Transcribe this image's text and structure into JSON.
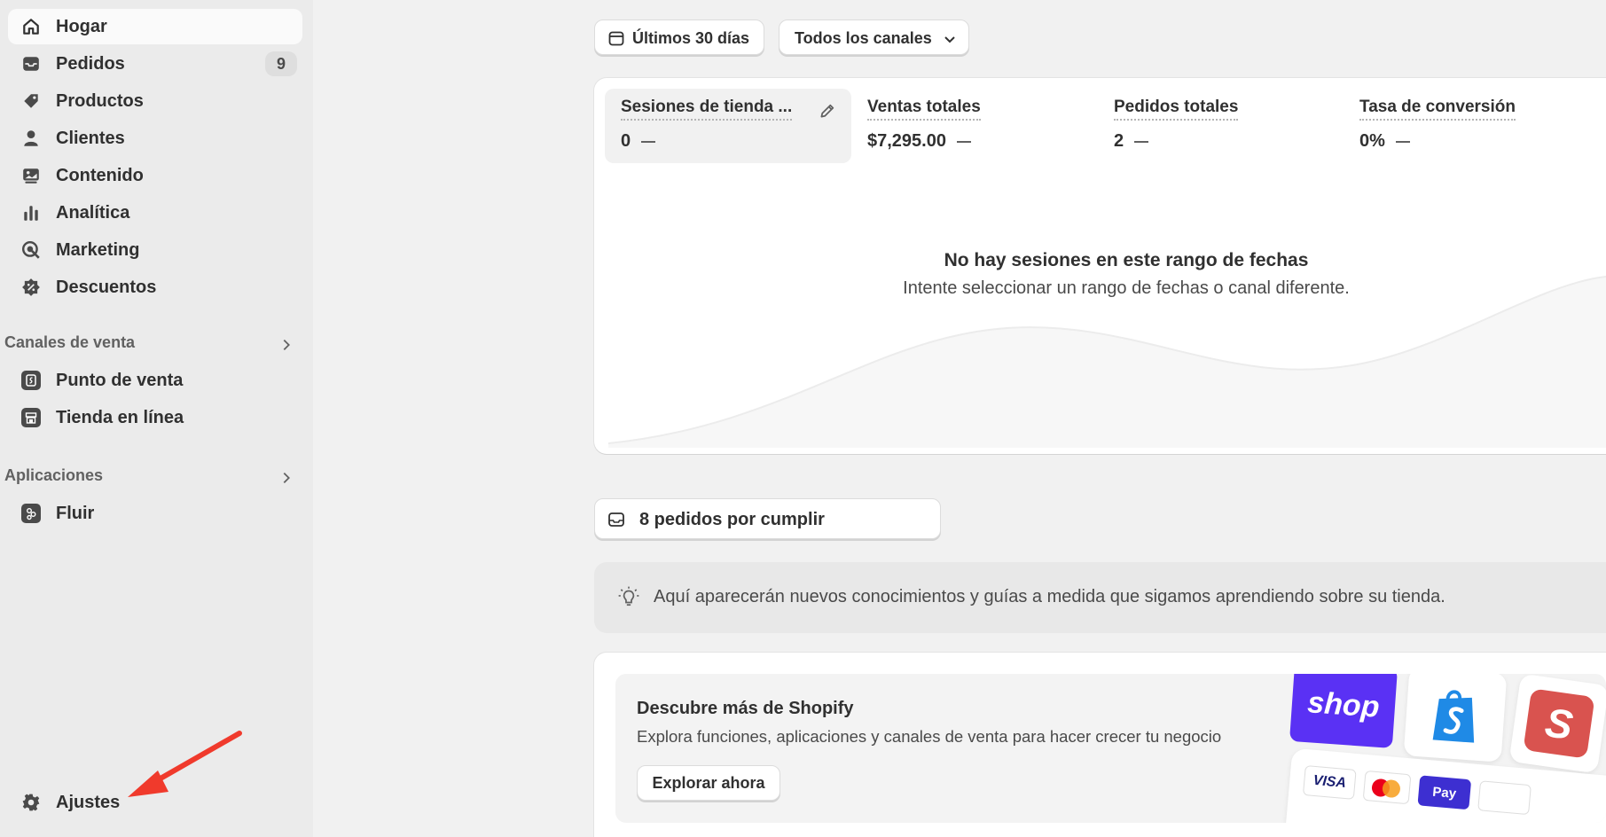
{
  "sidebar": {
    "nav": [
      {
        "label": "Hogar",
        "icon": "home-icon",
        "active": true
      },
      {
        "label": "Pedidos",
        "icon": "inbox-icon",
        "badge": "9"
      },
      {
        "label": "Productos",
        "icon": "tag-icon"
      },
      {
        "label": "Clientes",
        "icon": "person-icon"
      },
      {
        "label": "Contenido",
        "icon": "image-icon"
      },
      {
        "label": "Analítica",
        "icon": "bar-chart-icon"
      },
      {
        "label": "Marketing",
        "icon": "target-icon"
      },
      {
        "label": "Descuentos",
        "icon": "discount-icon"
      }
    ],
    "sales_channels": {
      "title": "Canales de venta",
      "items": [
        {
          "label": "Punto de venta",
          "icon": "pos-icon"
        },
        {
          "label": "Tienda en línea",
          "icon": "storefront-icon"
        }
      ]
    },
    "apps": {
      "title": "Aplicaciones",
      "items": [
        {
          "label": "Fluir",
          "icon": "flow-icon"
        }
      ]
    },
    "settings_label": "Ajustes"
  },
  "filters": {
    "date_range": "Últimos 30 días",
    "channel": "Todos los canales"
  },
  "metrics": [
    {
      "label": "Sesiones de tienda ...",
      "value": "0",
      "selected": true
    },
    {
      "label": "Ventas totales",
      "value": "$7,295.00"
    },
    {
      "label": "Pedidos totales",
      "value": "2"
    },
    {
      "label": "Tasa de conversión",
      "value": "0%"
    }
  ],
  "empty_state": {
    "title": "No hay sesiones en este rango de fechas",
    "subtitle": "Intente seleccionar un rango de fechas o canal diferente."
  },
  "orders_pill": "8 pedidos por cumplir",
  "insight_text": "Aquí aparecerán nuevos conocimientos y guías a medida que sigamos aprendiendo sobre su tienda.",
  "promo": {
    "title": "Descubre más de Shopify",
    "subtitle": "Explora funciones, aplicaciones y canales de venta para hacer crecer tu negocio",
    "button": "Explorar ahora",
    "shop_logo_text": "shop",
    "visa_text": "VISA",
    "pay_text": "Pay"
  },
  "colors": {
    "shop_purple": "#5a31f4",
    "shopify_blue": "#1f8ae6",
    "red_tile": "#d9534f",
    "annotation_arrow": "#f03a2c"
  }
}
